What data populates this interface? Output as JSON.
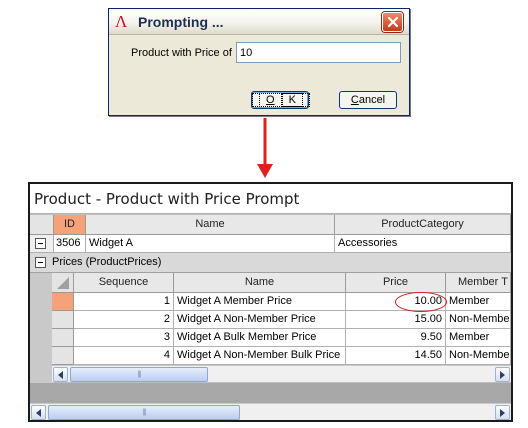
{
  "dialog": {
    "logo": "Λ",
    "title": "Prompting ...",
    "field_label": "Product with Price of",
    "field_value": "10",
    "ok_label": "OK",
    "ok_accel": "O",
    "ok_rest": "K",
    "cancel_accel": "C",
    "cancel_rest": "ancel"
  },
  "product": {
    "title": "Product - Product with Price Prompt",
    "columns": [
      "ID",
      "Name",
      "ProductCategory"
    ],
    "row": {
      "id": "3506",
      "name": "Widget A",
      "category": "Accessories"
    },
    "band_label": "Prices (ProductPrices)"
  },
  "prices": {
    "columns": [
      "Sequence",
      "Name",
      "Price",
      "Member T"
    ],
    "rows": [
      {
        "sequence": "1",
        "name": "Widget A Member Price",
        "price": "10.00",
        "member": "Member"
      },
      {
        "sequence": "2",
        "name": "Widget A Non-Member Price",
        "price": "15.00",
        "member": "Non-Membe"
      },
      {
        "sequence": "3",
        "name": "Widget A Bulk Member Price",
        "price": "9.50",
        "member": "Member"
      },
      {
        "sequence": "4",
        "name": "Widget A Non-Member Bulk Price",
        "price": "14.50",
        "member": "Non-Membe"
      }
    ]
  },
  "colors": {
    "highlight": "#d81e1e",
    "active_row_selector": "#f5a27a",
    "arrow": "#e02020"
  }
}
